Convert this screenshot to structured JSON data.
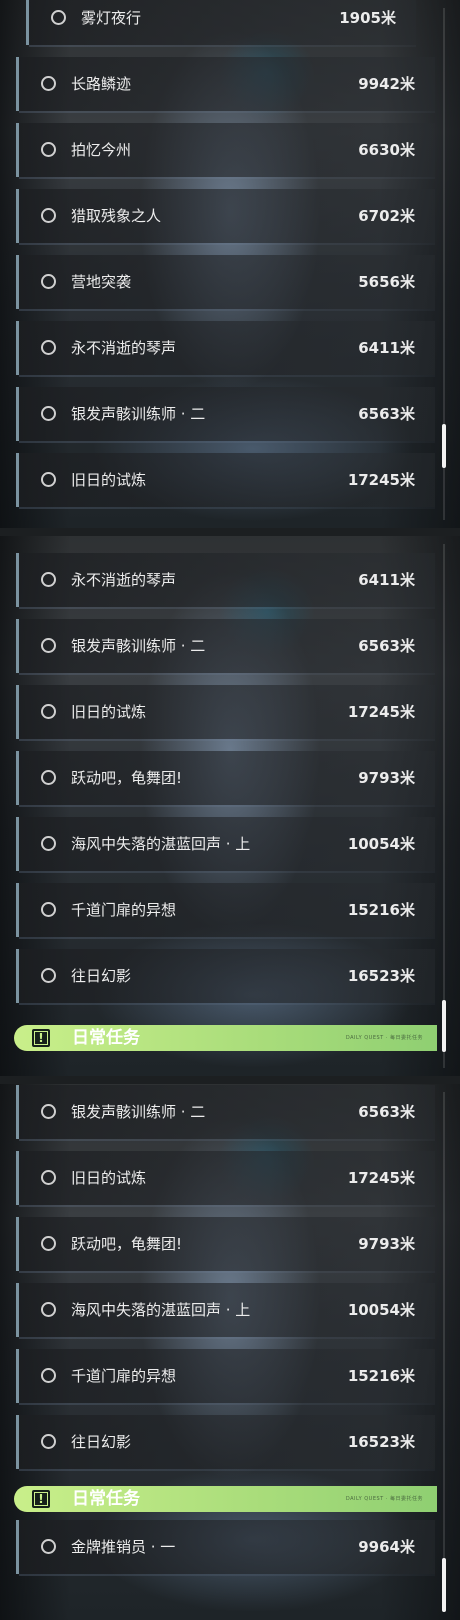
{
  "panels": [
    {
      "items": [
        {
          "name": "雾灯夜行",
          "dist": "1905米"
        },
        {
          "name": "长路鳞迹",
          "dist": "9942米"
        },
        {
          "name": "拍忆今州",
          "dist": "6630米"
        },
        {
          "name": "猎取残象之人",
          "dist": "6702米"
        },
        {
          "name": "营地突袭",
          "dist": "5656米"
        },
        {
          "name": "永不消逝的琴声",
          "dist": "6411米"
        },
        {
          "name": "银发声骸训练师 · 二",
          "dist": "6563米"
        },
        {
          "name": "旧日的试炼",
          "dist": "17245米"
        }
      ]
    },
    {
      "items": [
        {
          "name": "永不消逝的琴声",
          "dist": "6411米"
        },
        {
          "name": "银发声骸训练师 · 二",
          "dist": "6563米"
        },
        {
          "name": "旧日的试炼",
          "dist": "17245米"
        },
        {
          "name": "跃动吧，龟舞团!",
          "dist": "9793米"
        },
        {
          "name": "海风中失落的湛蓝回声 · 上",
          "dist": "10054米"
        },
        {
          "name": "千道门扉的异想",
          "dist": "15216米"
        },
        {
          "name": "往日幻影",
          "dist": "16523米"
        }
      ],
      "header": {
        "title": "日常任务",
        "sub": "DAILY QUEST · 每日委托任务"
      }
    },
    {
      "items": [
        {
          "name": "银发声骸训练师 · 二",
          "dist": "6563米"
        },
        {
          "name": "旧日的试炼",
          "dist": "17245米"
        },
        {
          "name": "跃动吧，龟舞团!",
          "dist": "9793米"
        },
        {
          "name": "海风中失落的湛蓝回声 · 上",
          "dist": "10054米"
        },
        {
          "name": "千道门扉的异想",
          "dist": "15216米"
        },
        {
          "name": "往日幻影",
          "dist": "16523米"
        }
      ],
      "header": {
        "title": "日常任务",
        "sub": "DAILY QUEST · 每日委托任务"
      },
      "after_header": [
        {
          "name": "金牌推销员 · 一",
          "dist": "9964米"
        }
      ]
    }
  ],
  "icons": {
    "quest_circle": "circle-outline-icon",
    "daily_header": "exclamation-box-icon"
  }
}
